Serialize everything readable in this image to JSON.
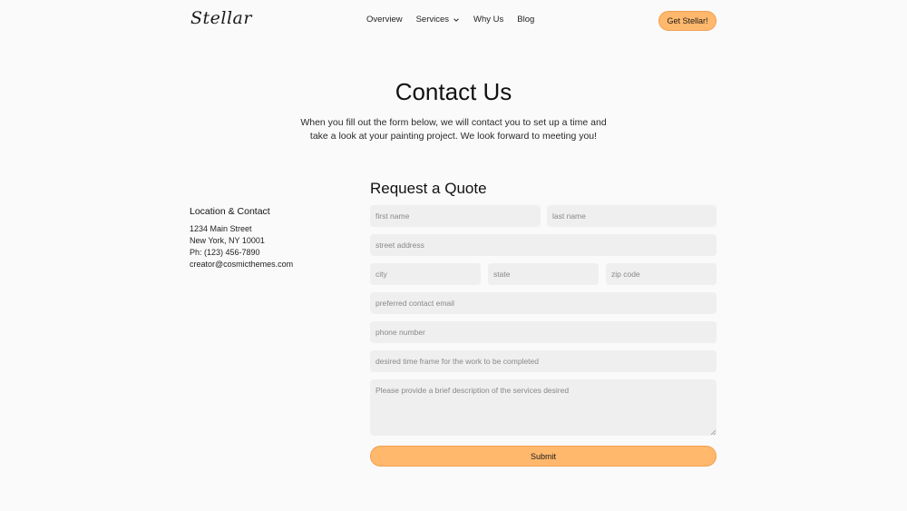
{
  "header": {
    "logo_text": "Stellar",
    "nav": [
      {
        "label": "Overview"
      },
      {
        "label": "Services"
      },
      {
        "label": "Why Us"
      },
      {
        "label": "Blog"
      }
    ],
    "cta_label": "Get Stellar!"
  },
  "hero": {
    "title": "Contact Us",
    "intro": "When you fill out the form below, we will contact you to set up a time and take a look at your painting project. We look forward to meeting you!"
  },
  "location": {
    "title": "Location & Contact",
    "lines": [
      "1234 Main Street",
      "New York, NY 10001",
      "Ph: (123) 456-7890",
      "creator@cosmicthemes.com"
    ]
  },
  "form": {
    "title": "Request a Quote",
    "first_name_placeholder": "first name",
    "last_name_placeholder": "last name",
    "street_placeholder": "street address",
    "city_placeholder": "city",
    "state_placeholder": "state",
    "zip_placeholder": "zip code",
    "email_placeholder": "preferred contact email",
    "phone_placeholder": "phone number",
    "timeframe_placeholder": "desired time frame for the work to be completed",
    "description_placeholder": "Please provide a brief description of the services desired",
    "submit_label": "Submit"
  },
  "colors": {
    "accent": "#ffb86c",
    "background": "#fafafa",
    "field": "#efefef"
  }
}
